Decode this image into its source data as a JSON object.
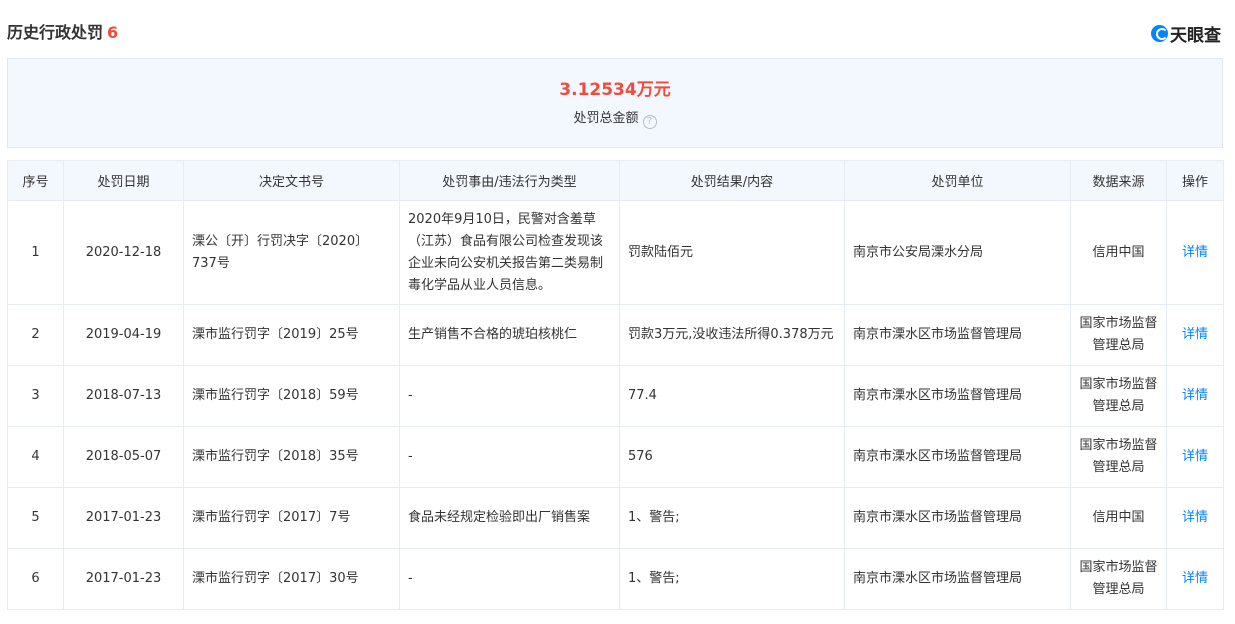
{
  "header": {
    "title": "历史行政处罚",
    "count": "6",
    "logo_text": "天眼查",
    "logo_icon": "tianyancha-logo-icon"
  },
  "summary": {
    "amount": "3.12534万元",
    "label": "处罚总金额",
    "help_icon": "question-circle-icon"
  },
  "table": {
    "columns": [
      "序号",
      "处罚日期",
      "决定文书号",
      "处罚事由/违法行为类型",
      "处罚结果/内容",
      "处罚单位",
      "数据来源",
      "操作"
    ],
    "rows": [
      {
        "index": "1",
        "date": "2020-12-18",
        "doc_no": "溧公〔开〕行罚决字〔2020〕737号",
        "reason": "2020年9月10日，民警对含羞草（江苏）食品有限公司检查发现该企业未向公安机关报告第二类易制毒化学品从业人员信息。",
        "result": "罚款陆佰元",
        "unit": "南京市公安局溧水分局",
        "source": "信用中国",
        "action": "详情"
      },
      {
        "index": "2",
        "date": "2019-04-19",
        "doc_no": "溧市监行罚字〔2019〕25号",
        "reason": "生产销售不合格的琥珀核桃仁",
        "result": "罚款3万元,没收违法所得0.378万元",
        "unit": "南京市溧水区市场监督管理局",
        "source": "国家市场监督管理总局",
        "action": "详情"
      },
      {
        "index": "3",
        "date": "2018-07-13",
        "doc_no": "溧市监行罚字〔2018〕59号",
        "reason": "-",
        "result": "77.4",
        "unit": "南京市溧水区市场监督管理局",
        "source": "国家市场监督管理总局",
        "action": "详情"
      },
      {
        "index": "4",
        "date": "2018-05-07",
        "doc_no": "溧市监行罚字〔2018〕35号",
        "reason": "-",
        "result": "576",
        "unit": "南京市溧水区市场监督管理局",
        "source": "国家市场监督管理总局",
        "action": "详情"
      },
      {
        "index": "5",
        "date": "2017-01-23",
        "doc_no": "溧市监行罚字〔2017〕7号",
        "reason": "食品未经规定检验即出厂销售案",
        "result": "1、警告;",
        "unit": "南京市溧水区市场监督管理局",
        "source": "信用中国",
        "action": "详情"
      },
      {
        "index": "6",
        "date": "2017-01-23",
        "doc_no": "溧市监行罚字〔2017〕30号",
        "reason": "-",
        "result": "1、警告;",
        "unit": "南京市溧水区市场监督管理局",
        "source": "国家市场监督管理总局",
        "action": "详情"
      }
    ]
  },
  "colors": {
    "accent": "#0084ff",
    "amount": "#f04b3c",
    "header_bg": "#f2f8fd",
    "border": "#e6ecf2"
  }
}
